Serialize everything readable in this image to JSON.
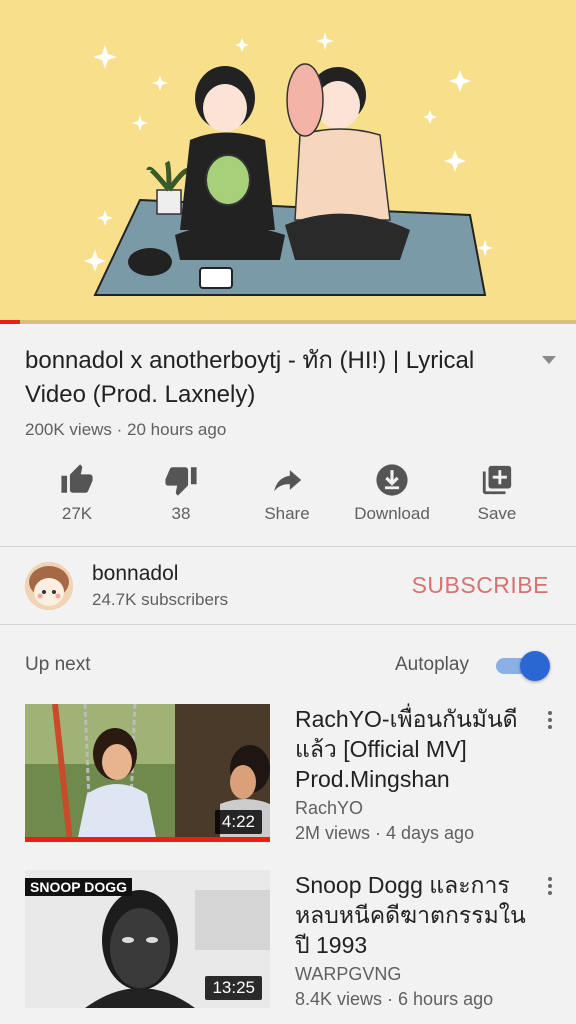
{
  "video": {
    "title": "bonnadol x anotherboytj - ทัก (HI!) | Lyrical Video (Prod. Laxnely)",
    "meta": "200K views · 20 hours ago",
    "progress": 0.035
  },
  "actions": [
    {
      "icon": "thumbs-up-icon",
      "label": "27K"
    },
    {
      "icon": "thumbs-down-icon",
      "label": "38"
    },
    {
      "icon": "share-icon",
      "label": "Share"
    },
    {
      "icon": "download-icon",
      "label": "Download"
    },
    {
      "icon": "save-playlist-icon",
      "label": "Save"
    }
  ],
  "channel": {
    "name": "bonnadol",
    "subscribers": "24.7K subscribers",
    "subscribe_label": "SUBSCRIBE"
  },
  "upnext": {
    "heading": "Up next",
    "autoplay_label": "Autoplay",
    "autoplay_on": true
  },
  "cards": [
    {
      "title": "RachYO-เพื่อนกันมันดีแล้ว [Official MV] Prod.Mingshan",
      "channel": "RachYO",
      "meta": "2M views · 4 days ago",
      "duration": "4:22",
      "badge": "",
      "watched": true
    },
    {
      "title": "Snoop Dogg และการหลบหนีคดีฆาตกรรมในปี 1993",
      "channel": "WARPGVNG",
      "meta": "8.4K views · 6 hours ago",
      "duration": "13:25",
      "badge": "SNOOP DOGG",
      "watched": false
    }
  ],
  "colors": {
    "accent_red": "#e62117",
    "subscribe": "#d77272",
    "toggle_knob": "#2b67d3",
    "player_bg": "#f8df8c"
  }
}
